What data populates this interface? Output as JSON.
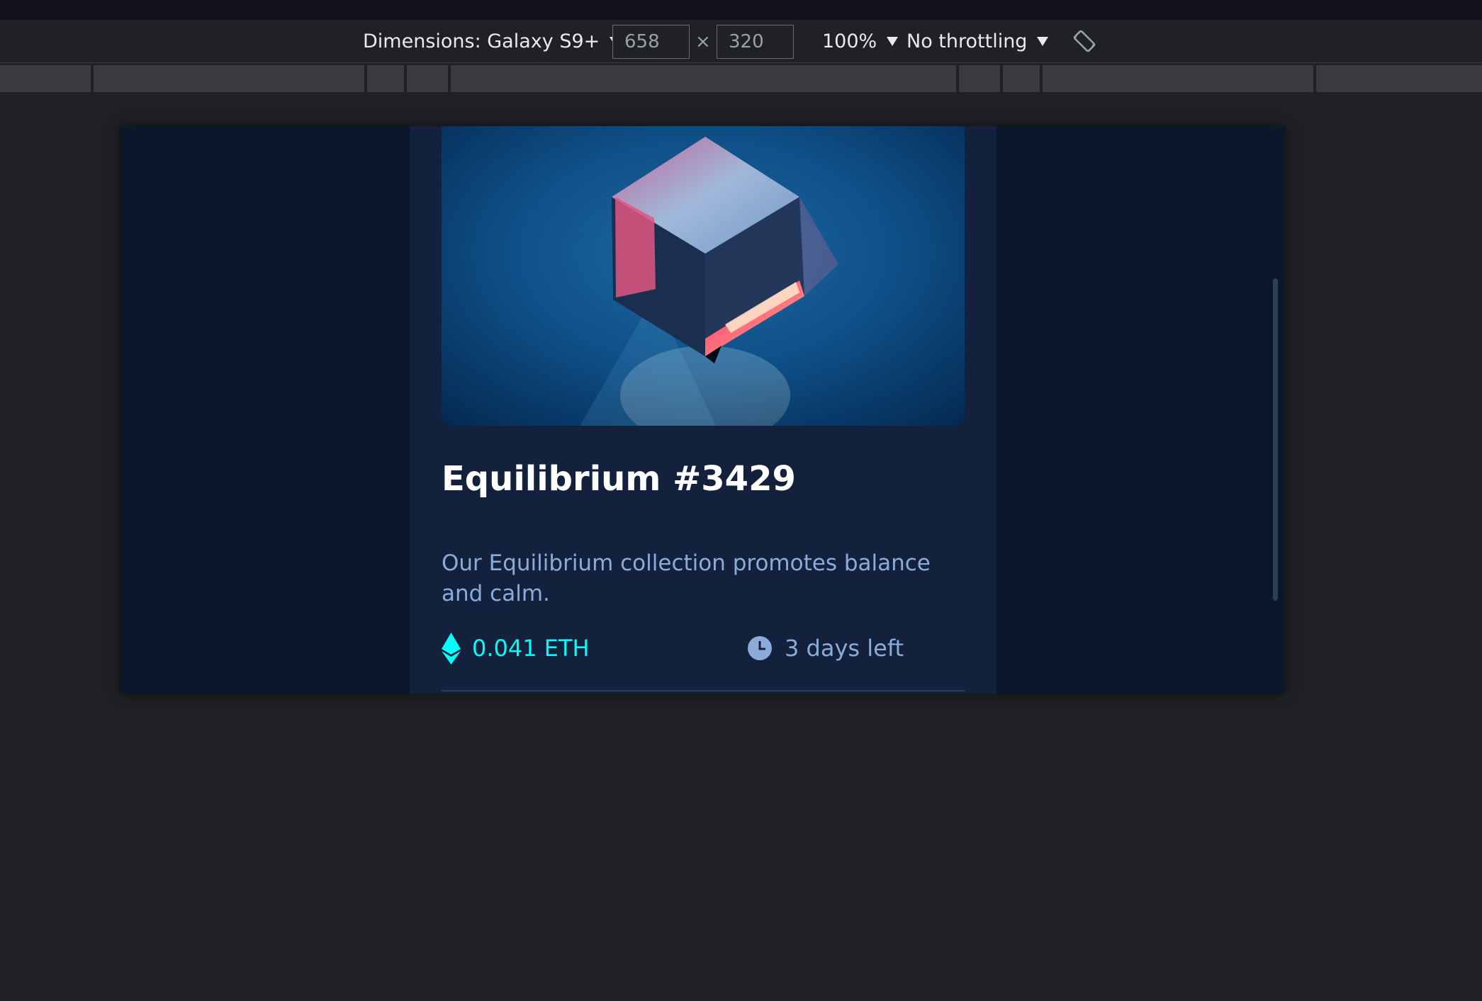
{
  "devtools": {
    "dimensions_label": "Dimensions: Galaxy S9+",
    "width_value": "658",
    "height_value": "320",
    "times_symbol": "×",
    "zoom": "100%",
    "throttling": "No throttling",
    "rotate_icon": "rotate-device-icon"
  },
  "card": {
    "image_icon": "crystal-cube-image",
    "title": "Equilibrium #3429",
    "description": "Our Equilibrium collection promotes balance and calm.",
    "price": "0.041 ETH",
    "price_icon": "ethereum-icon",
    "time_left": "3 days left",
    "time_icon": "clock-icon"
  },
  "colors": {
    "page_bg": "#0b182b",
    "card_bg": "#14213d",
    "cyan": "#00fff8",
    "soft_blue": "#8bacd9",
    "white": "#ffffff",
    "devtools_bg": "#202124"
  }
}
